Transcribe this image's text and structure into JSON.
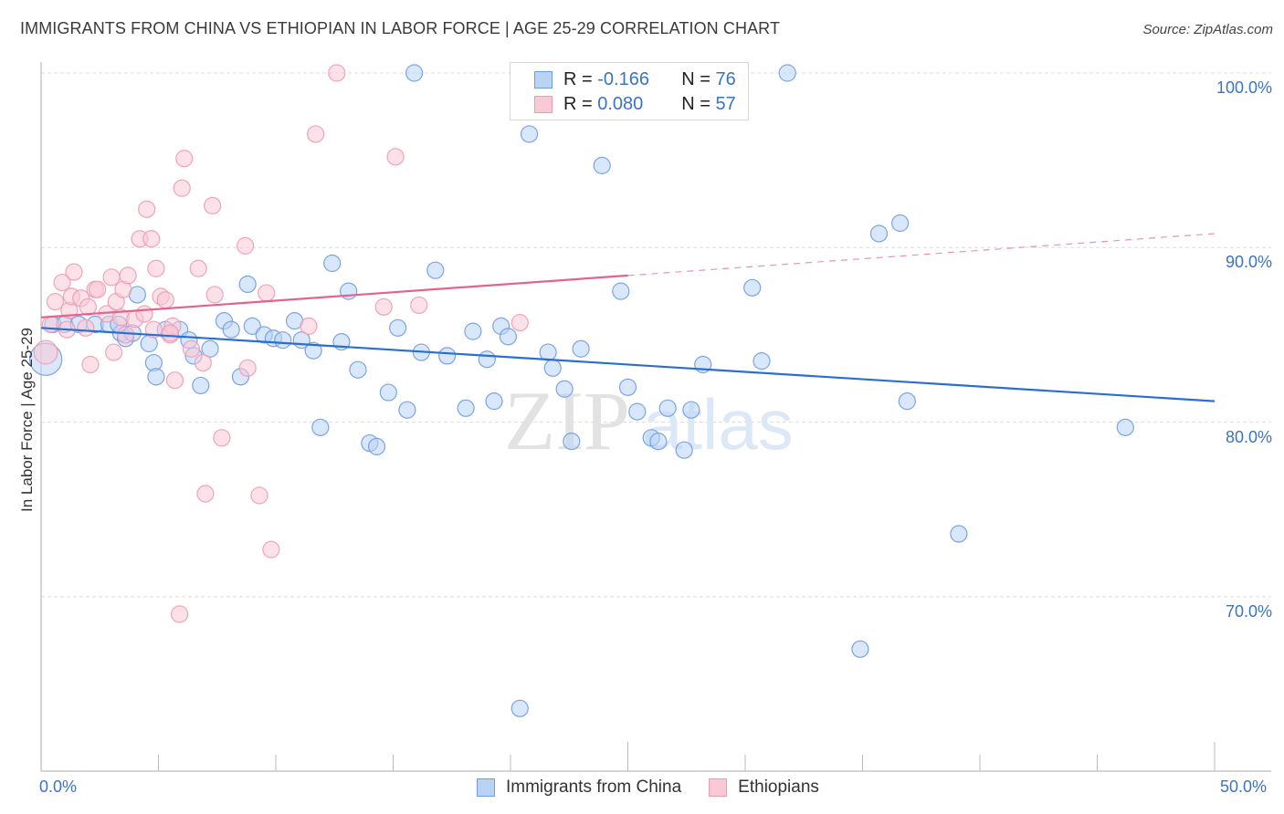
{
  "header": {
    "title": "IMMIGRANTS FROM CHINA VS ETHIOPIAN IN LABOR FORCE | AGE 25-29 CORRELATION CHART",
    "source": "Source: ZipAtlas.com"
  },
  "legend": {
    "rows": [
      {
        "r_label": "R =",
        "r_value": "-0.166",
        "n_label": "N =",
        "n_value": "76"
      },
      {
        "r_label": "R =",
        "r_value": "0.080",
        "n_label": "N =",
        "n_value": "57"
      }
    ]
  },
  "watermark": {
    "zip": "ZIP",
    "atlas": "atlas"
  },
  "chart_data": {
    "type": "scatter",
    "title": "IMMIGRANTS FROM CHINA VS ETHIOPIAN IN LABOR FORCE | AGE 25-29 CORRELATION CHART",
    "xlabel": "",
    "ylabel": "In Labor Force | Age 25-29",
    "xlim": [
      0,
      50
    ],
    "ylim": [
      60,
      101.5
    ],
    "x_tick_labels": [
      "0.0%",
      "50.0%"
    ],
    "y_ticks": [
      70,
      80,
      90,
      100
    ],
    "y_tick_labels": [
      "70.0%",
      "80.0%",
      "90.0%",
      "100.0%"
    ],
    "grid": true,
    "legend_position": "top-center",
    "colors": {
      "china": "#6f9be0",
      "china_fill": "#b9d3f5",
      "china_line": "#2a6fd0",
      "ethiopians": "#ee9ab2",
      "ethiopians_fill": "#f9c9d6",
      "ethiopians_line": "#e2648e"
    },
    "series": [
      {
        "name": "Immigrants from China",
        "r": -0.166,
        "n": 76,
        "trend": {
          "x0": 0,
          "y0": 85.4,
          "x1": 50,
          "y1": 81.2,
          "dashed_from": null
        },
        "points": [
          [
            0.2,
            83.6,
            2.2
          ],
          [
            0.5,
            85.6
          ],
          [
            1.0,
            85.6
          ],
          [
            1.6,
            85.6
          ],
          [
            2.3,
            85.6
          ],
          [
            2.9,
            85.6
          ],
          [
            3.4,
            85.1
          ],
          [
            3.3,
            85.6
          ],
          [
            3.6,
            84.8
          ],
          [
            3.9,
            85.1
          ],
          [
            4.1,
            87.3
          ],
          [
            4.6,
            84.5
          ],
          [
            4.8,
            83.4
          ],
          [
            4.9,
            82.6
          ],
          [
            5.3,
            85.3
          ],
          [
            5.9,
            85.3
          ],
          [
            6.3,
            84.7
          ],
          [
            6.5,
            83.8
          ],
          [
            6.8,
            82.1
          ],
          [
            7.2,
            84.2
          ],
          [
            7.8,
            85.8
          ],
          [
            8.1,
            85.3
          ],
          [
            8.5,
            82.6
          ],
          [
            8.8,
            87.9
          ],
          [
            9.0,
            85.5
          ],
          [
            9.5,
            85.0
          ],
          [
            9.9,
            84.8
          ],
          [
            10.3,
            84.7
          ],
          [
            10.8,
            85.8
          ],
          [
            11.1,
            84.7
          ],
          [
            11.6,
            84.1
          ],
          [
            11.9,
            79.7
          ],
          [
            12.4,
            89.1
          ],
          [
            12.8,
            84.6
          ],
          [
            13.1,
            87.5
          ],
          [
            13.5,
            83.0
          ],
          [
            14.0,
            78.8
          ],
          [
            14.3,
            78.6
          ],
          [
            14.8,
            81.7
          ],
          [
            15.2,
            85.4
          ],
          [
            15.6,
            80.7
          ],
          [
            15.9,
            100.0
          ],
          [
            16.2,
            84.0
          ],
          [
            16.8,
            88.7
          ],
          [
            17.3,
            83.8
          ],
          [
            18.1,
            80.8
          ],
          [
            18.4,
            85.2
          ],
          [
            19.0,
            83.6
          ],
          [
            19.3,
            81.2
          ],
          [
            19.6,
            85.5
          ],
          [
            19.9,
            84.9
          ],
          [
            20.4,
            63.6
          ],
          [
            20.8,
            96.5
          ],
          [
            21.6,
            84.0
          ],
          [
            21.8,
            83.1
          ],
          [
            22.3,
            81.9
          ],
          [
            22.6,
            78.9
          ],
          [
            23.0,
            84.2
          ],
          [
            23.9,
            94.7
          ],
          [
            24.7,
            87.5
          ],
          [
            25.0,
            82.0
          ],
          [
            25.4,
            80.6
          ],
          [
            26.0,
            79.1
          ],
          [
            26.3,
            78.9
          ],
          [
            26.7,
            80.8
          ],
          [
            27.4,
            78.4
          ],
          [
            27.7,
            80.7
          ],
          [
            28.2,
            83.3
          ],
          [
            30.3,
            87.7
          ],
          [
            30.7,
            83.5
          ],
          [
            31.8,
            100.0
          ],
          [
            34.9,
            67.0
          ],
          [
            35.7,
            90.8
          ],
          [
            36.6,
            91.4
          ],
          [
            36.9,
            81.2
          ],
          [
            39.1,
            73.6
          ],
          [
            46.2,
            79.7
          ]
        ]
      },
      {
        "name": "Ethiopians",
        "r": 0.08,
        "n": 57,
        "trend": {
          "x0": 0,
          "y0": 86.0,
          "x1": 50,
          "y1": 90.8,
          "dashed_from": 25
        },
        "points": [
          [
            0.2,
            84.0,
            1.6
          ],
          [
            0.4,
            85.6
          ],
          [
            0.6,
            86.9
          ],
          [
            0.9,
            88.0
          ],
          [
            1.1,
            85.3
          ],
          [
            1.2,
            86.4
          ],
          [
            1.3,
            87.2
          ],
          [
            1.4,
            88.6
          ],
          [
            1.7,
            87.1
          ],
          [
            1.9,
            85.4
          ],
          [
            2.0,
            86.6
          ],
          [
            2.1,
            83.3
          ],
          [
            2.3,
            87.6
          ],
          [
            2.4,
            87.6
          ],
          [
            2.8,
            86.2
          ],
          [
            3.0,
            88.3
          ],
          [
            3.1,
            84.0
          ],
          [
            3.2,
            86.9
          ],
          [
            3.4,
            86.0
          ],
          [
            3.5,
            87.6
          ],
          [
            3.7,
            88.4
          ],
          [
            4.0,
            85.9
          ],
          [
            4.2,
            90.5
          ],
          [
            4.4,
            86.2
          ],
          [
            4.5,
            92.2
          ],
          [
            4.7,
            90.5
          ],
          [
            4.8,
            85.3
          ],
          [
            4.9,
            88.8
          ],
          [
            5.1,
            87.2
          ],
          [
            5.3,
            87.0
          ],
          [
            5.5,
            85.0
          ],
          [
            5.6,
            85.5
          ],
          [
            5.7,
            82.4
          ],
          [
            6.0,
            93.4
          ],
          [
            6.1,
            95.1
          ],
          [
            6.4,
            84.2
          ],
          [
            6.7,
            88.8
          ],
          [
            6.9,
            83.4
          ],
          [
            7.0,
            75.9
          ],
          [
            7.3,
            92.4
          ],
          [
            7.4,
            87.3
          ],
          [
            7.7,
            79.1
          ],
          [
            8.7,
            90.1
          ],
          [
            8.8,
            83.1
          ],
          [
            9.3,
            75.8
          ],
          [
            9.6,
            87.4
          ],
          [
            9.8,
            72.7
          ],
          [
            11.4,
            85.5
          ],
          [
            11.7,
            96.5
          ],
          [
            12.6,
            100.0
          ],
          [
            14.6,
            86.6
          ],
          [
            15.1,
            95.2
          ],
          [
            16.1,
            86.7
          ],
          [
            20.4,
            85.7
          ],
          [
            5.9,
            69.0
          ],
          [
            5.5,
            85.1
          ],
          [
            3.6,
            85.0
          ]
        ]
      }
    ]
  },
  "axis": {
    "x_min_label": "0.0%",
    "x_max_label": "50.0%",
    "y_labels": [
      "100.0%",
      "90.0%",
      "80.0%",
      "70.0%"
    ],
    "y_title": "In Labor Force | Age 25-29"
  },
  "bottom_legend": {
    "items": [
      {
        "label": "Immigrants from China"
      },
      {
        "label": "Ethiopians"
      }
    ]
  }
}
